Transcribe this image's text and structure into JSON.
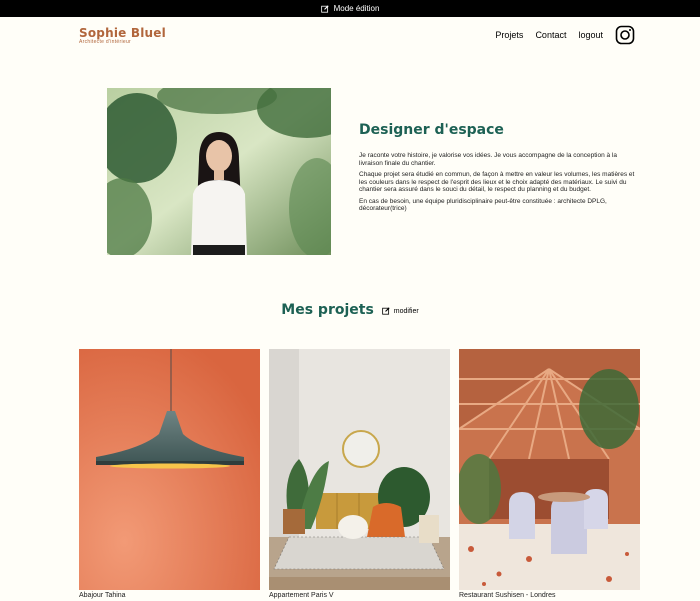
{
  "edit_bar": {
    "label": "Mode édition"
  },
  "header": {
    "logo_title": "Sophie Bluel",
    "logo_subtitle": "Architecte d'intérieur",
    "nav": [
      "Projets",
      "Contact",
      "logout"
    ],
    "instagram_icon": "instagram-icon"
  },
  "intro": {
    "title": "Designer d'espace",
    "paragraphs": [
      "Je raconte votre histoire, je valorise vos idées. Je vous accompagne de la conception à la livraison finale du chantier.",
      "Chaque projet sera étudié en commun, de façon à mettre en valeur les volumes, les matières et les couleurs dans le respect de l'esprit des lieux et le choix adapté des matériaux. Le suivi du chantier sera assuré dans le souci du détail, le respect du planning et du budget.",
      "En cas de besoin, une équipe pluridisciplinaire peut-être constituée : architecte DPLG, décorateur(trice)"
    ]
  },
  "projects": {
    "title": "Mes projets",
    "modify_label": "modifier",
    "items": [
      {
        "caption": "Abajour Tahina"
      },
      {
        "caption": "Appartement Paris V"
      },
      {
        "caption": "Restaurant Sushisen - Londres"
      }
    ]
  },
  "colors": {
    "accent": "#1d6154",
    "brand": "#b1663c",
    "background": "#fffef8"
  }
}
